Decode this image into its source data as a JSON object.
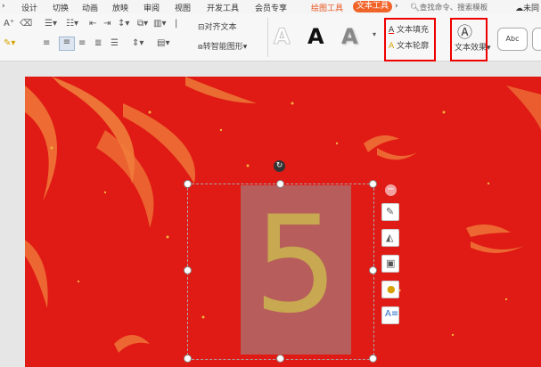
{
  "menu": {
    "items": [
      "设计",
      "切换",
      "动画",
      "放映",
      "审阅",
      "视图",
      "开发工具",
      "会员专享",
      "绘图工具",
      "文本工具"
    ],
    "search": "查找命令、搜索模板",
    "right_partial": "未同"
  },
  "ribbon": {
    "align_text": "对齐文本",
    "smart_art": "转智能图形",
    "text_fill": "文本填充",
    "text_outline": "文本轮廓",
    "text_effect": "文本效果",
    "abc": "Abc",
    "wordart_glyph": "A"
  },
  "slide": {
    "digit": "5"
  },
  "colors": {
    "slide_bg": "#e01a14",
    "accent": "#f0642a",
    "highlight_box": "#ee0000",
    "digit": "#c8a850"
  }
}
